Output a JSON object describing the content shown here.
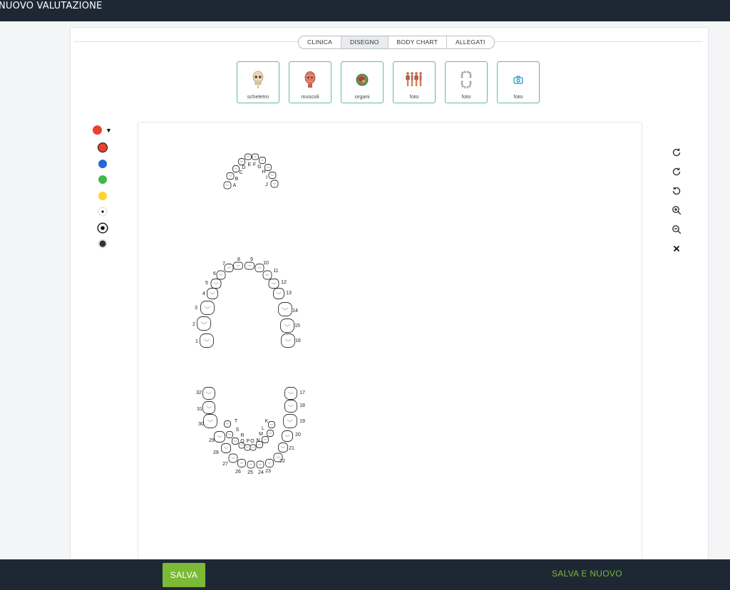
{
  "header": {
    "title": "NUOVO VALUTAZIONE"
  },
  "tabs": [
    {
      "label": "CLINICA",
      "active": false
    },
    {
      "label": "DISEGNO",
      "active": true
    },
    {
      "label": "BODY CHART",
      "active": false
    },
    {
      "label": "ALLEGATI",
      "active": false
    }
  ],
  "templates": [
    {
      "label": "scheletro",
      "icon": "skull-icon"
    },
    {
      "label": "muscoli",
      "icon": "muscles-icon"
    },
    {
      "label": "organi",
      "icon": "organs-icon"
    },
    {
      "label": "foto",
      "icon": "body-figures-icon"
    },
    {
      "label": "foto",
      "icon": "teeth-chart-icon"
    },
    {
      "label": "foto",
      "icon": "camera-icon"
    }
  ],
  "colors": {
    "selected": "#e8432f",
    "palette": [
      "#e8432f",
      "#2767d6",
      "#3eb84a",
      "#fbd52e"
    ],
    "dark": "#222222",
    "accent": "#7cb936",
    "template_border": "#5fbf9f",
    "bar": "#1e2835"
  },
  "brush_sizes": [
    "small",
    "medium",
    "large"
  ],
  "tools": [
    "redo-icon",
    "redo-icon",
    "undo-icon",
    "zoom-in-icon",
    "zoom-out-icon",
    "close-icon"
  ],
  "teeth": {
    "upper_numbers": [
      "1",
      "2",
      "3",
      "4",
      "5",
      "6",
      "7",
      "8",
      "9",
      "10",
      "11",
      "12",
      "13",
      "14",
      "15",
      "16"
    ],
    "upper_letters": [
      "A",
      "B",
      "C",
      "D",
      "E",
      "F",
      "G",
      "H",
      "I",
      "J"
    ],
    "lower_numbers": [
      "17",
      "18",
      "19",
      "20",
      "21",
      "22",
      "23",
      "24",
      "25",
      "26",
      "27",
      "28",
      "29",
      "30",
      "31",
      "32"
    ],
    "lower_letters": [
      "K",
      "L",
      "M",
      "N",
      "O",
      "P",
      "Q",
      "R",
      "S",
      "T"
    ]
  },
  "footer": {
    "save_label": "SALVA",
    "save_new_label": "SALVA E NUOVO"
  }
}
